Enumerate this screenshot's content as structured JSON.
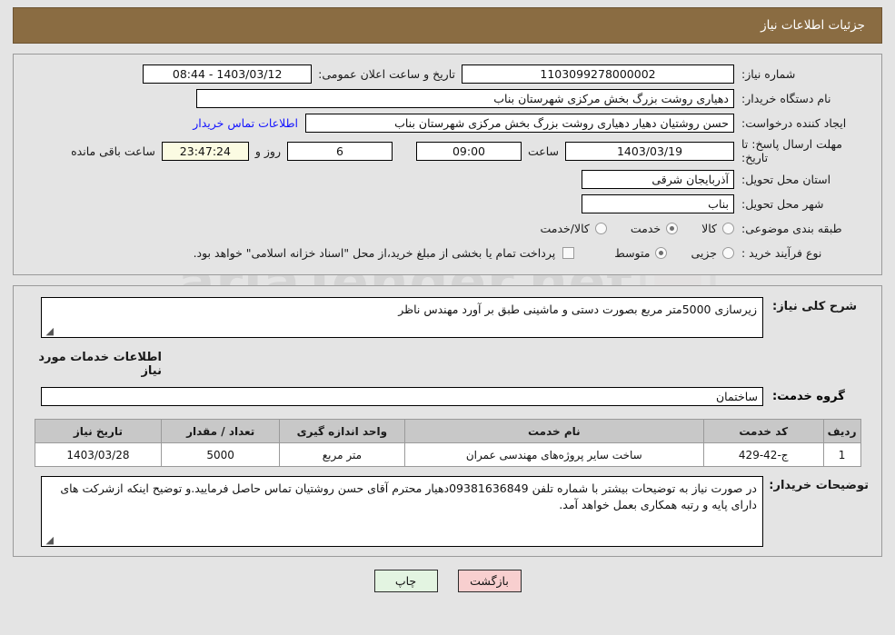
{
  "header": {
    "title": "جزئیات اطلاعات نیاز"
  },
  "watermark": {
    "text": "ariaTender.net"
  },
  "top_form": {
    "need_no_label": "شماره نیاز:",
    "need_no_value": "1103099278000002",
    "announce_label": "تاریخ و ساعت اعلان عمومی:",
    "announce_value": "1403/03/12 - 08:44",
    "org_label": "نام دستگاه خریدار:",
    "org_value": "دهیاری روشت بزرگ بخش مرکزی شهرستان بناب",
    "creator_label": "ایجاد کننده درخواست:",
    "creator_value": "حسن روشتیان دهیار دهیاری روشت بزرگ بخش مرکزی شهرستان بناب",
    "contact_link": "اطلاعات تماس خریدار",
    "deadline_label": "مهلت ارسال پاسخ: تا تاریخ:",
    "deadline_date": "1403/03/19",
    "hour_label": "ساعت",
    "deadline_time": "09:00",
    "days_value": "6",
    "days_label": "روز و",
    "countdown_value": "23:47:24",
    "countdown_label": "ساعت باقی مانده",
    "province_label": "استان محل تحویل:",
    "province_value": "آذربایجان شرقی",
    "city_label": "شهر محل تحویل:",
    "city_value": "بناب",
    "category_label": "طبقه بندی موضوعی:",
    "category_options": [
      {
        "label": "کالا",
        "selected": false
      },
      {
        "label": "خدمت",
        "selected": true
      },
      {
        "label": "کالا/خدمت",
        "selected": false
      }
    ],
    "process_label": "نوع فرآیند خرید :",
    "process_options": [
      {
        "label": "جزیی",
        "selected": false
      },
      {
        "label": "متوسط",
        "selected": true
      }
    ],
    "treasury_checked": false,
    "treasury_note": "پرداخت تمام یا بخشی از مبلغ خرید،از محل \"اسناد خزانه اسلامی\" خواهد بود."
  },
  "main": {
    "desc_label": "شرح کلی نیاز:",
    "desc_value": "زیرسازی 5000متر مربع بصورت دستی و ماشینی طبق بر آورد مهندس ناظر",
    "section_title": "اطلاعات خدمات مورد نیاز",
    "svc_group_label": "گروه خدمت:",
    "svc_group_value": "ساختمان",
    "table": {
      "headers": [
        "ردیف",
        "کد خدمت",
        "نام خدمت",
        "واحد اندازه گیری",
        "تعداد / مقدار",
        "تاریخ نیاز"
      ],
      "rows": [
        {
          "row_no": "1",
          "code": "ج-42-429",
          "name": "ساخت سایر پروژه‌های مهندسی عمران",
          "unit": "متر مربع",
          "qty": "5000",
          "need_date": "1403/03/28"
        }
      ]
    },
    "buyer_notes_label": "توضیحات خریدار:",
    "buyer_notes_value": "در صورت نیاز به توضیحات بیشتر با شماره تلفن 09381636849دهیار محترم آقای حسن روشتیان تماس حاصل فرمایید.و توضیح اینکه  ازشرکت های دارای پایه و رتبه همکاری بعمل خواهد آمد."
  },
  "buttons": {
    "back": "بازگشت",
    "print": "چاپ"
  },
  "colors": {
    "header_bg": "#8a6c42",
    "page_bg": "#e4e4e4",
    "link": "#1414ff",
    "countdown_bg": "#fbfbe2",
    "back_btn": "#f8cfcf",
    "print_btn": "#e3f4e1",
    "table_header_bg": "#c8c8c8"
  }
}
